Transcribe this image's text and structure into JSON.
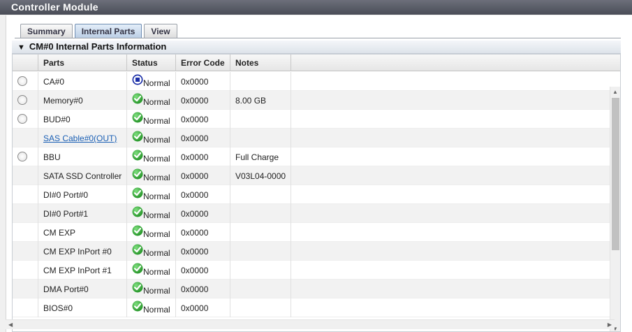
{
  "window": {
    "title": "Controller Module"
  },
  "tabs": [
    {
      "label": "Summary",
      "active": false
    },
    {
      "label": "Internal Parts",
      "active": true
    },
    {
      "label": "View",
      "active": false
    }
  ],
  "section": {
    "title": "CM#0 Internal Parts Information"
  },
  "table": {
    "columns": [
      "Parts",
      "Status",
      "Error Code",
      "Notes"
    ],
    "rows": [
      {
        "part": "CA#0",
        "status": "Normal",
        "status_icon": "info-blue-square-icon",
        "error_code": "0x0000",
        "notes": "",
        "selectable": true,
        "link": false
      },
      {
        "part": "Memory#0",
        "status": "Normal",
        "status_icon": "check-green-icon",
        "error_code": "0x0000",
        "notes": "8.00 GB",
        "selectable": true,
        "link": false
      },
      {
        "part": "BUD#0",
        "status": "Normal",
        "status_icon": "check-green-icon",
        "error_code": "0x0000",
        "notes": "",
        "selectable": true,
        "link": false
      },
      {
        "part": "SAS Cable#0(OUT)",
        "status": "Normal",
        "status_icon": "check-green-icon",
        "error_code": "0x0000",
        "notes": "",
        "selectable": false,
        "link": true
      },
      {
        "part": "BBU",
        "status": "Normal",
        "status_icon": "check-green-icon",
        "error_code": "0x0000",
        "notes": "Full Charge",
        "selectable": true,
        "link": false
      },
      {
        "part": "SATA SSD Controller",
        "status": "Normal",
        "status_icon": "check-green-icon",
        "error_code": "0x0000",
        "notes": "V03L04-0000",
        "selectable": false,
        "link": false
      },
      {
        "part": "DI#0 Port#0",
        "status": "Normal",
        "status_icon": "check-green-icon",
        "error_code": "0x0000",
        "notes": "",
        "selectable": false,
        "link": false
      },
      {
        "part": "DI#0 Port#1",
        "status": "Normal",
        "status_icon": "check-green-icon",
        "error_code": "0x0000",
        "notes": "",
        "selectable": false,
        "link": false
      },
      {
        "part": "CM EXP",
        "status": "Normal",
        "status_icon": "check-green-icon",
        "error_code": "0x0000",
        "notes": "",
        "selectable": false,
        "link": false
      },
      {
        "part": "CM EXP InPort #0",
        "status": "Normal",
        "status_icon": "check-green-icon",
        "error_code": "0x0000",
        "notes": "",
        "selectable": false,
        "link": false
      },
      {
        "part": "CM EXP InPort #1",
        "status": "Normal",
        "status_icon": "check-green-icon",
        "error_code": "0x0000",
        "notes": "",
        "selectable": false,
        "link": false
      },
      {
        "part": "DMA Port#0",
        "status": "Normal",
        "status_icon": "check-green-icon",
        "error_code": "0x0000",
        "notes": "",
        "selectable": false,
        "link": false
      },
      {
        "part": "BIOS#0",
        "status": "Normal",
        "status_icon": "check-green-icon",
        "error_code": "0x0000",
        "notes": "",
        "selectable": false,
        "link": false
      }
    ]
  },
  "colors": {
    "title_bar": "#55585f",
    "link": "#1a5fb4",
    "status_ok": "#2fa332",
    "status_info": "#1b2fa8"
  }
}
